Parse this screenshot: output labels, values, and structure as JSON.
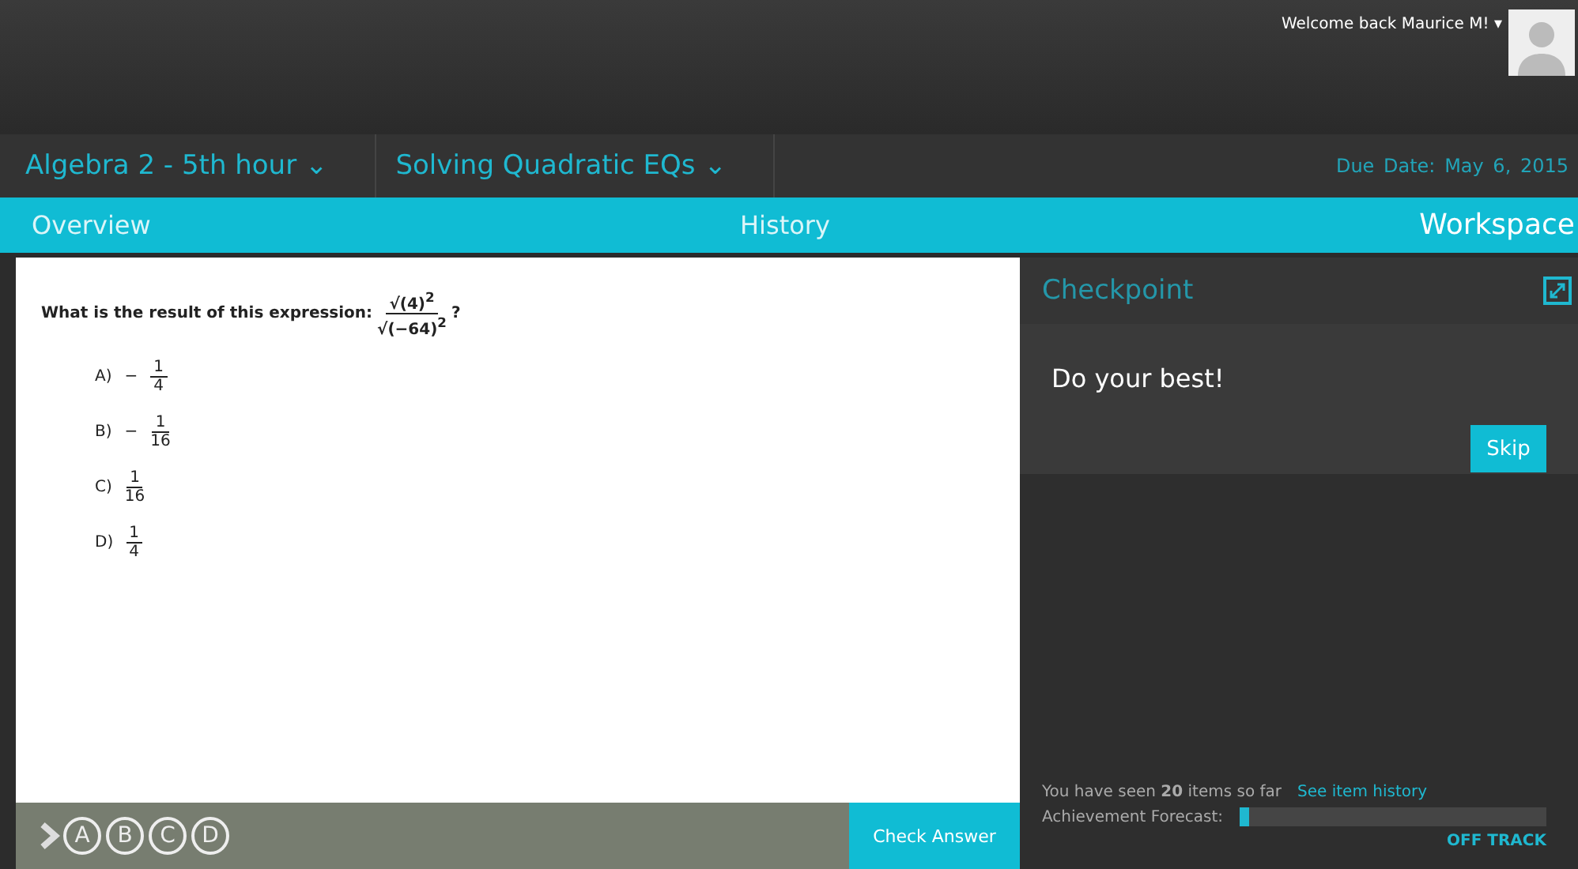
{
  "header": {
    "welcome": "Welcome back Maurice M!",
    "caret": "▾"
  },
  "breadcrumbs": [
    {
      "label": "Algebra 2 - 5th hour",
      "caret": "⌄"
    },
    {
      "label": "Solving Quadratic EQs",
      "caret": "⌄"
    }
  ],
  "due": {
    "label": "Due Date:",
    "value": "May 6, 2015"
  },
  "tabs": [
    {
      "label": "Overview",
      "selected": false
    },
    {
      "label": "History",
      "selected": false
    },
    {
      "label": "Workspace",
      "selected": true
    }
  ],
  "question": {
    "prompt": "What is the result of this expression:",
    "numerator": "√(4)$^{2}$",
    "denominator": "√(−64)$^{2}$",
    "end": "?"
  },
  "options": [
    {
      "letter": "A)",
      "sign": "−",
      "numerator": "1",
      "denominator": "4"
    },
    {
      "letter": "B)",
      "sign": "−",
      "numerator": "1",
      "denominator": "16"
    },
    {
      "letter": "C)",
      "numerator": "1",
      "denominator": "16"
    },
    {
      "letter": "D)",
      "numerator": "1",
      "denominator": "4"
    }
  ],
  "answer_bar": {
    "choices": [
      "A",
      "B",
      "C",
      "D"
    ],
    "button": "Check Answer"
  },
  "checkpoint": {
    "title": "Checkpoint",
    "message": "Do your best!",
    "skip": "Skip"
  },
  "progress": {
    "seen": "You have seen **20** items so far",
    "link": "See item history",
    "forecast_label": "Achievement Forecast:",
    "level": 0.02,
    "status": "OFF TRACK"
  }
}
